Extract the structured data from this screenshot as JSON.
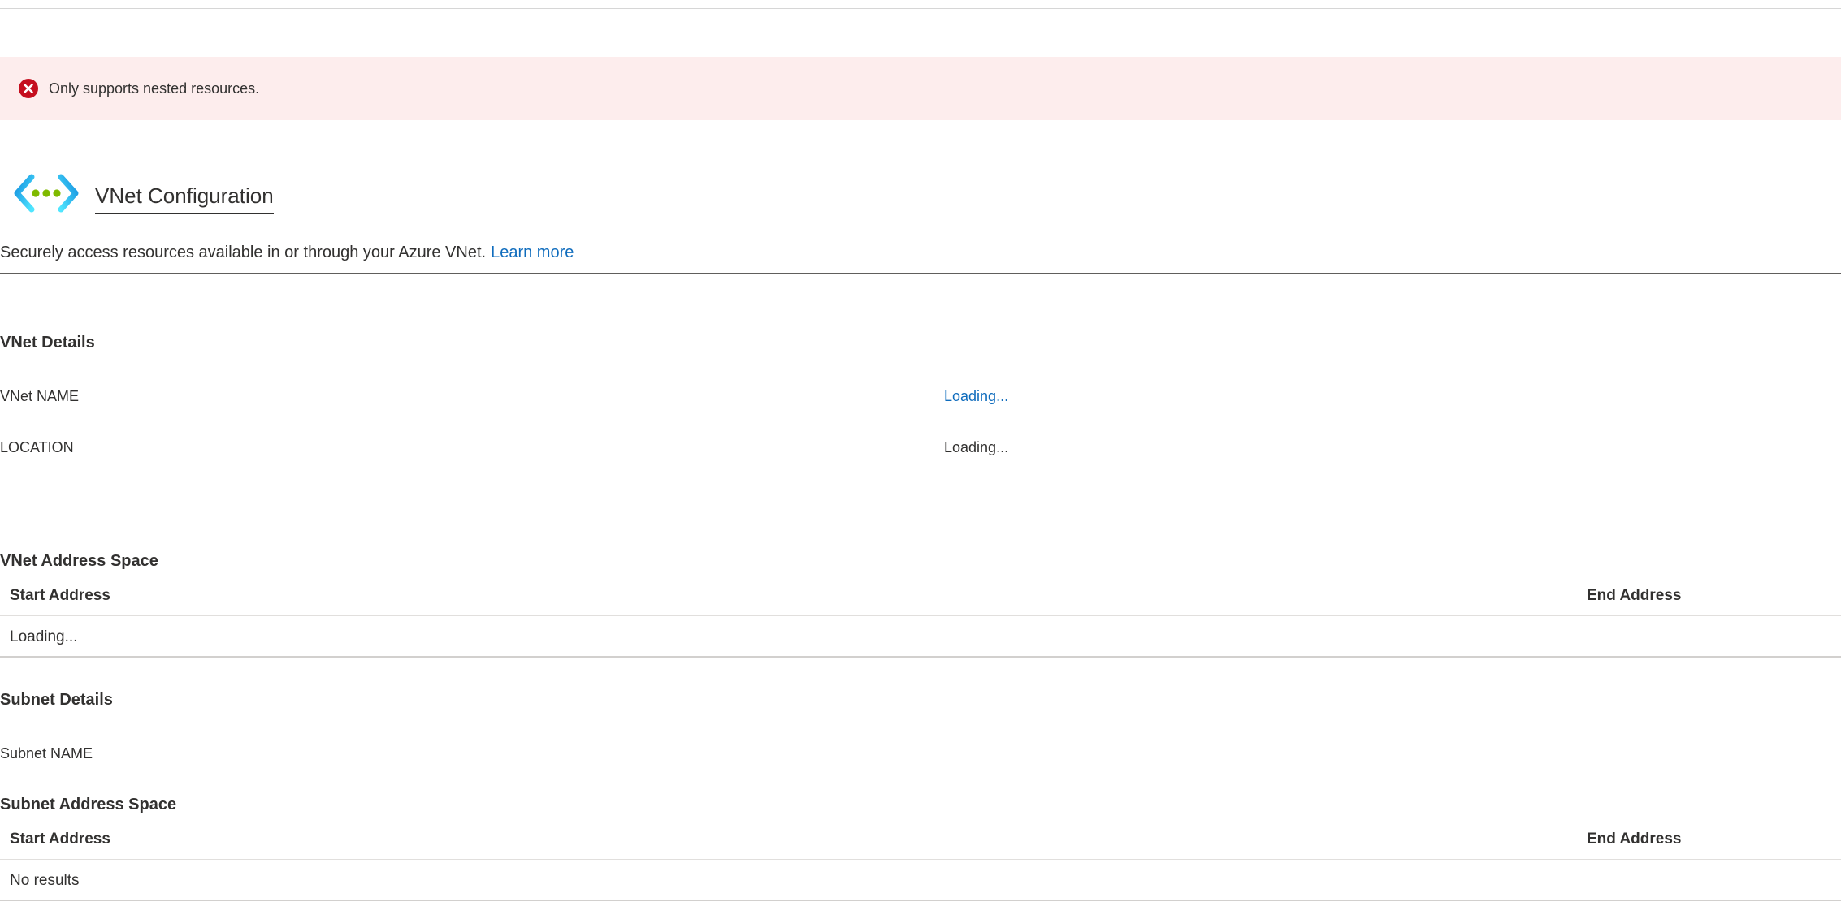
{
  "alert": {
    "icon": "error-circle-icon",
    "message": "Only supports nested resources.",
    "color": "#c50f1f"
  },
  "header": {
    "icon": "virtual-network-icon",
    "title": "VNet Configuration"
  },
  "description": {
    "text": "Securely access resources available in or through your Azure VNet.",
    "link_label": "Learn more"
  },
  "vnet_details": {
    "heading": "VNet Details",
    "fields": [
      {
        "label": "VNet NAME",
        "value": "Loading..."
      },
      {
        "label": "LOCATION",
        "value": "Loading..."
      }
    ]
  },
  "vnet_address_space": {
    "heading": "VNet Address Space",
    "columns": [
      "Start Address",
      "End Address"
    ],
    "rows": [
      "Loading..."
    ]
  },
  "subnet_details": {
    "heading": "Subnet Details",
    "fields": [
      {
        "label": "Subnet NAME",
        "value": ""
      }
    ]
  },
  "subnet_address_space": {
    "heading": "Subnet Address Space",
    "columns": [
      "Start Address",
      "End Address"
    ],
    "rows": [
      "No results"
    ]
  },
  "colors": {
    "link": "#0f6cbd",
    "error_background": "#fdeded",
    "text": "#323130"
  }
}
